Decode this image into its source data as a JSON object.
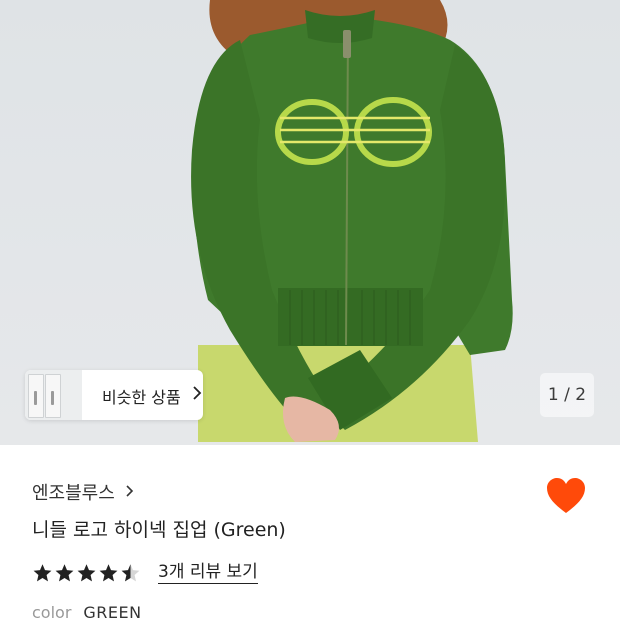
{
  "gallery": {
    "counter": "1 / 2",
    "similar_products": {
      "label": "비슷한 상품"
    }
  },
  "product": {
    "brand": "엔조블루스",
    "title": "니들 로고 하이넥 집업 (Green)",
    "liked": true,
    "rating": 4.5,
    "review_link": "3개 리뷰 보기",
    "color": {
      "label": "color",
      "value": "GREEN"
    }
  },
  "colors": {
    "heart": "#ff4a0a",
    "sweater": "#3f7a2c",
    "logo": "#b7d94a"
  }
}
